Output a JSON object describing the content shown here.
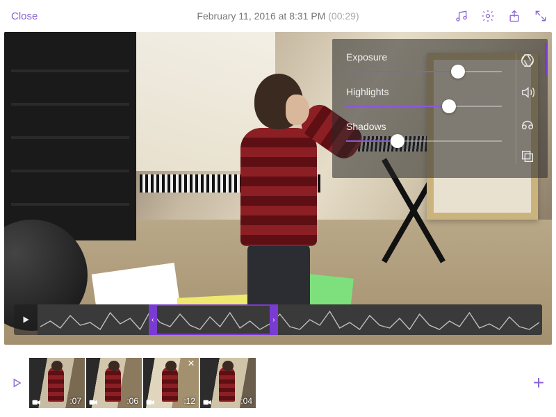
{
  "topbar": {
    "close_label": "Close",
    "title_text": "February 11, 2016 at 8:31 PM",
    "duration_text": "(00:29)"
  },
  "toolbar_icons": {
    "music": "music-icon",
    "settings": "gear-icon",
    "share": "share-icon",
    "fullscreen": "expand-icon"
  },
  "adjust_panel": {
    "sliders": [
      {
        "label": "Exposure",
        "value_pct": 72
      },
      {
        "label": "Highlights",
        "value_pct": 66
      },
      {
        "label": "Shadows",
        "value_pct": 33
      }
    ],
    "side_tools": [
      "aperture-icon",
      "volume-icon",
      "speed-icon",
      "copy-icon"
    ]
  },
  "trim": {
    "start_pct": 22,
    "end_pct": 46
  },
  "clips": [
    {
      "duration": ":07",
      "selected": false
    },
    {
      "duration": ":06",
      "selected": false
    },
    {
      "duration": ":12",
      "selected": true
    },
    {
      "duration": ":04",
      "selected": false
    }
  ],
  "colors": {
    "accent": "#793bd1",
    "link": "#8a63d2"
  }
}
